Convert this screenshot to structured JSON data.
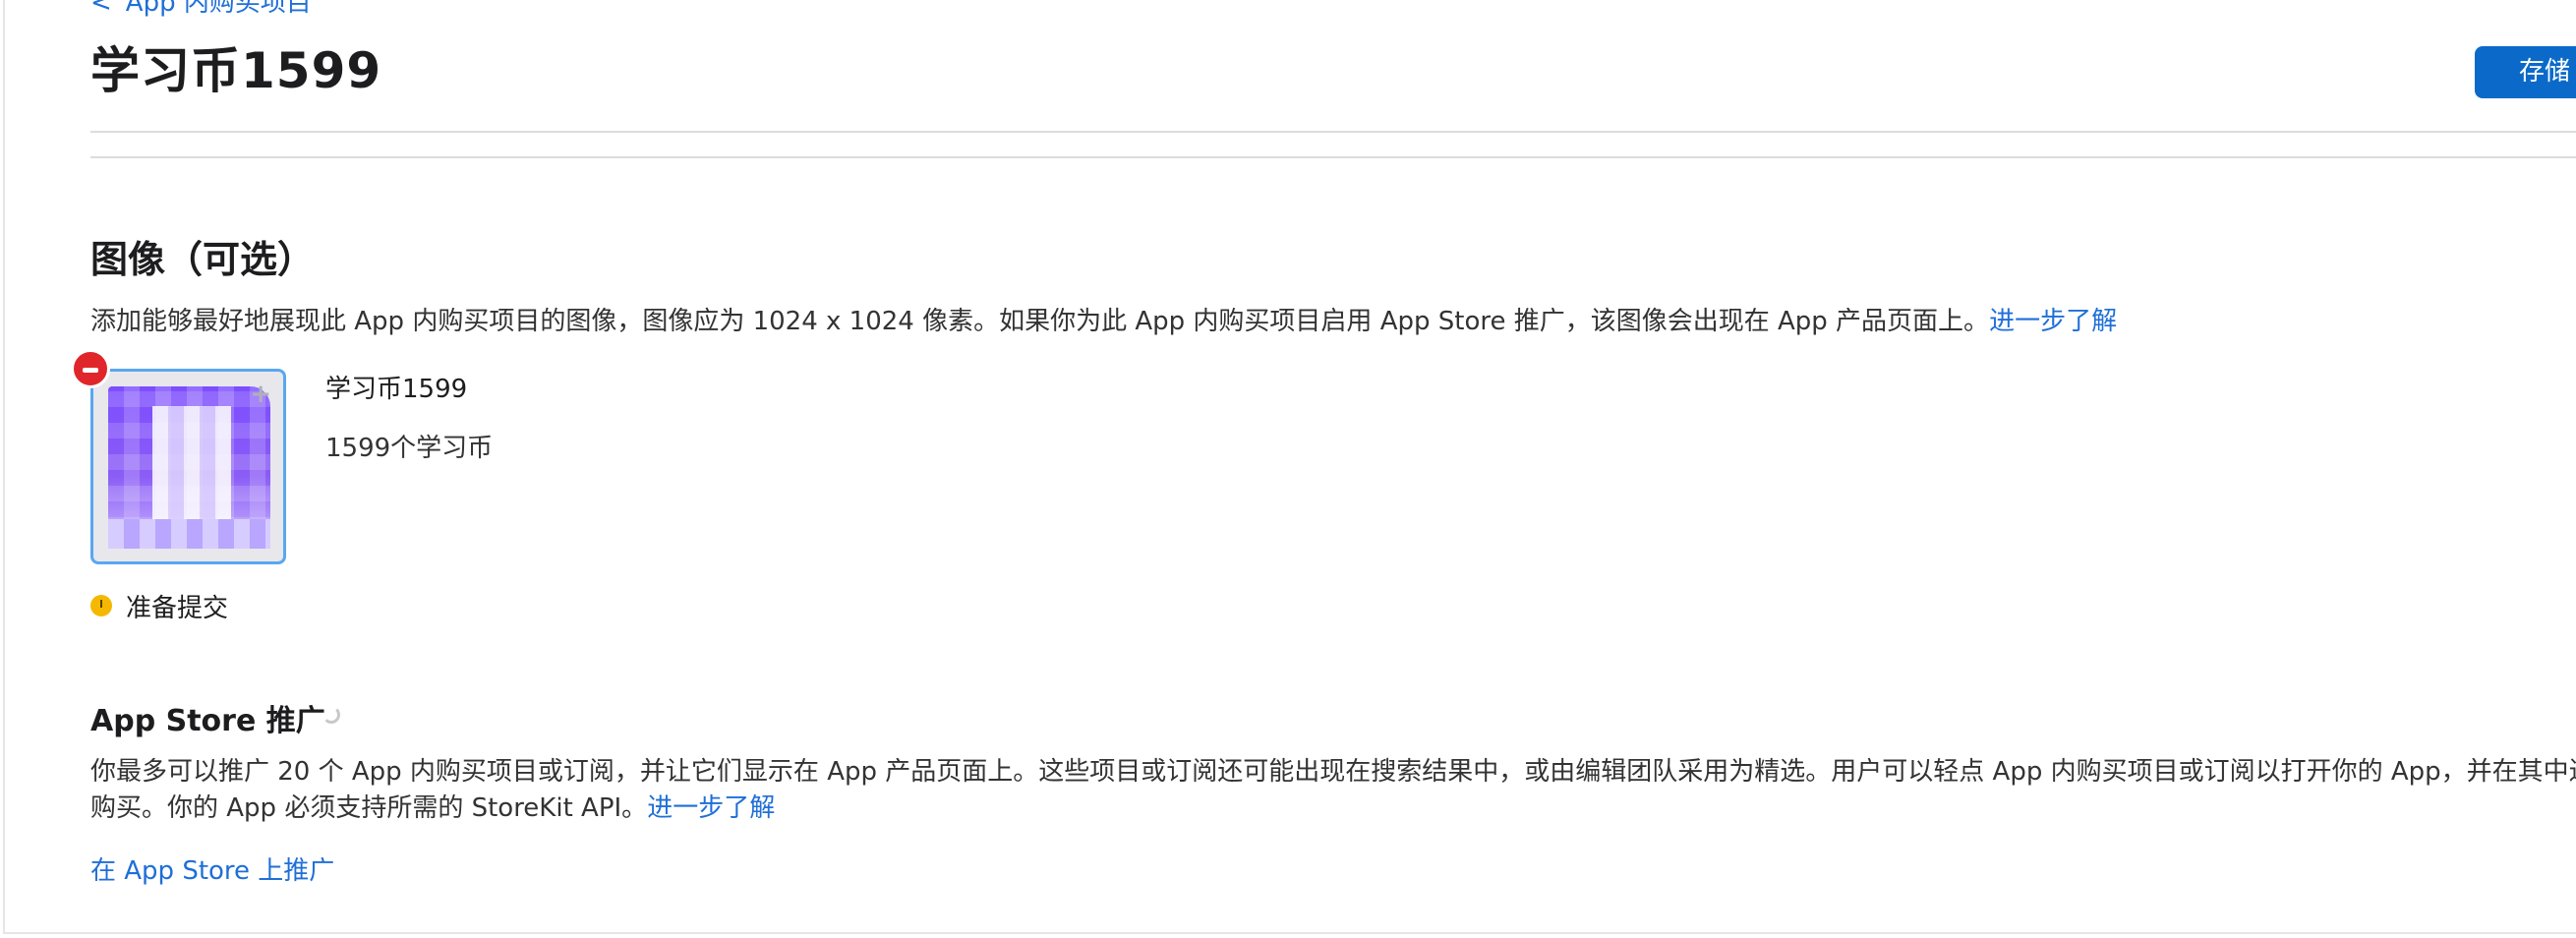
{
  "breadcrumb": {
    "chevron": "<",
    "label": "App 内购买项目"
  },
  "header": {
    "title": "学习币1599",
    "save_label": "存储"
  },
  "image_section": {
    "title": "图像（可选）",
    "description": "添加能够最好地展现此 App 内购买项目的图像，图像应为 1024 x 1024 像素。如果你为此 App 内购买项目启用 App Store 推广，该图像会出现在 App 产品页面上。",
    "learn_more": "进一步了解"
  },
  "item": {
    "name": "学习币1599",
    "description": "1599个学习币",
    "thumb_plus": "+"
  },
  "status": {
    "label": "准备提交",
    "color": "#f5b800"
  },
  "promotion": {
    "title": "App Store 推广",
    "description_line1": "你最多可以推广 20 个 App 内购买项目或订阅，并让它们显示在 App 产品页面上。这些项目或订阅还可能出现在搜索结果中，或由编辑团队采用为精选。用户可以轻点 App 内购买项目或订阅以打开你的 App，并在其中进行",
    "description_line2": "购买。你的 App 必须支持所需的 StoreKit API。",
    "learn_more": "进一步了解",
    "action_label": "在 App Store 上推广"
  },
  "colors": {
    "accent": "#1f6fd8",
    "button": "#0b6ac9",
    "remove": "#e0262a"
  }
}
